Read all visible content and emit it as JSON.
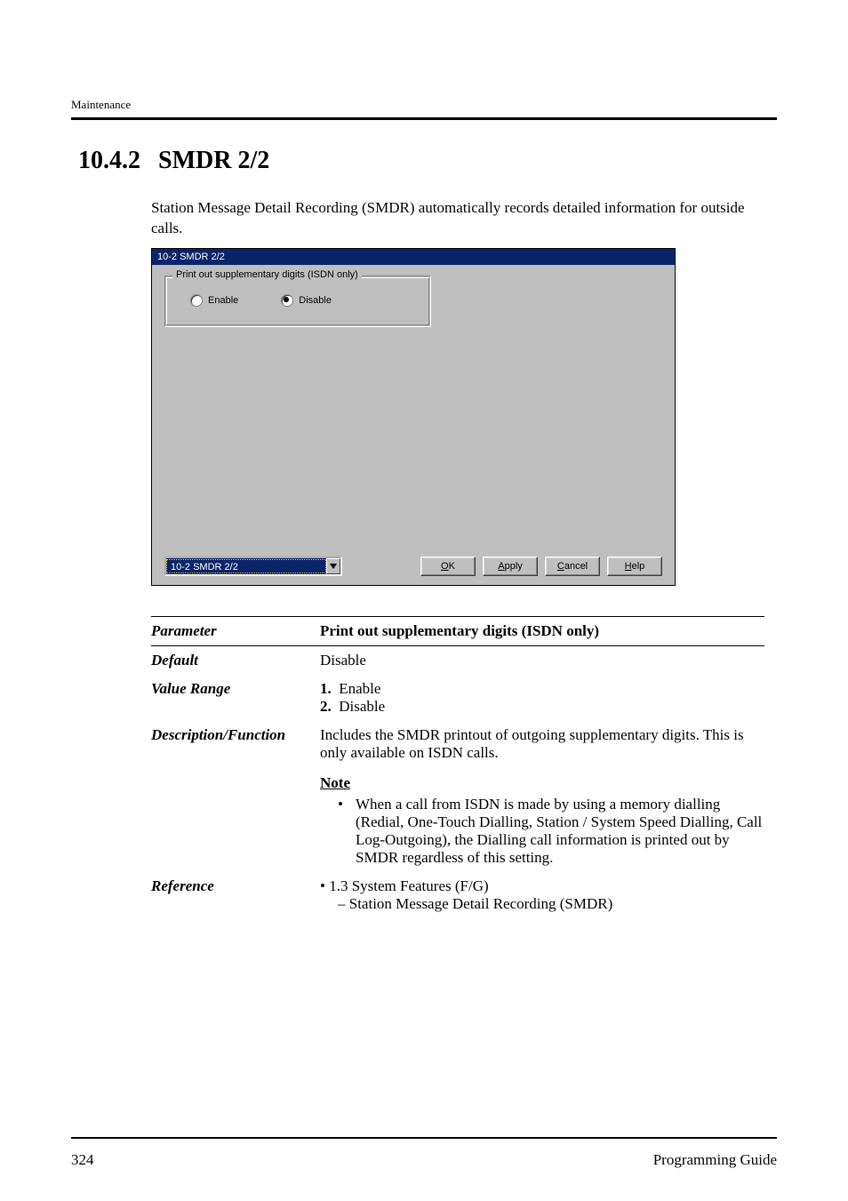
{
  "header": {
    "running": "Maintenance"
  },
  "section": {
    "number": "10.4.2",
    "title": "SMDR 2/2"
  },
  "intro": "Station Message Detail Recording (SMDR) automatically records detailed information for outside calls.",
  "dialog": {
    "title": "10-2 SMDR 2/2",
    "group_legend": "Print out supplementary digits  (ISDN only)",
    "radios": {
      "enable": "Enable",
      "disable": "Disable",
      "selected": "disable"
    },
    "combo_value": "10-2 SMDR 2/2",
    "buttons": {
      "ok_u": "O",
      "ok_rest": "K",
      "apply_u": "A",
      "apply_rest": "pply",
      "cancel_u": "C",
      "cancel_rest": "ancel",
      "help_u": "H",
      "help_rest": "elp"
    }
  },
  "params": {
    "labels": {
      "parameter": "Parameter",
      "default": "Default",
      "value_range": "Value Range",
      "description": "Description/Function",
      "reference": "Reference"
    },
    "parameter_value": "Print out supplementary digits (ISDN only)",
    "default_value": "Disable",
    "value_range": {
      "n1": "1.",
      "v1": "Enable",
      "n2": "2.",
      "v2": "Disable"
    },
    "description_main": "Includes the SMDR printout of outgoing supplementary digits. This is only available on ISDN calls.",
    "note_heading": "Note",
    "note_bullet": "When a call from ISDN is made by using a memory dialling (Redial, One-Touch Dialling, Station / System Speed Dialling, Call Log-Outgoing), the Dialling call information is printed out by SMDR regardless of this setting.",
    "reference_line": "• 1.3 System Features (F/G)",
    "reference_sub": "– Station Message Detail Recording (SMDR)"
  },
  "footer": {
    "page": "324",
    "title": "Programming Guide"
  }
}
